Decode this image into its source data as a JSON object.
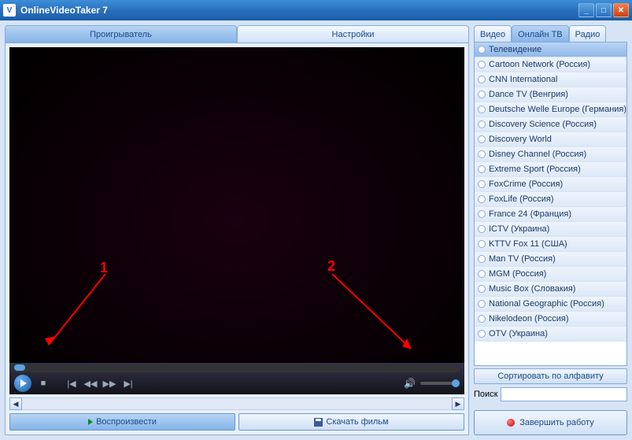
{
  "window": {
    "title": "OnlineVideoTaker 7"
  },
  "mainTabs": {
    "player": "Проигрыватель",
    "settings": "Настройки"
  },
  "sideTabs": {
    "video": "Видео",
    "onlineTV": "Онлайн ТВ",
    "radio": "Радио"
  },
  "buttons": {
    "play": "Воспроизвести",
    "download": "Скачать фильм",
    "sort": "Сортировать по алфавиту",
    "search": "Поиск",
    "exit": "Завершить работу"
  },
  "annotations": {
    "n1": "1",
    "n2": "2"
  },
  "channels": [
    "Телевидение",
    "Cartoon Network (Россия)",
    "CNN International",
    "Dance TV (Венгрия)",
    "Deutsche Welle Europe (Германия)",
    "Discovery Science (Россия)",
    "Discovery World",
    "Disney Channel (Россия)",
    "Extreme Sport (Россия)",
    "FoxCrime (Россия)",
    "FoxLife (Россия)",
    "France 24 (Франция)",
    "ICTV (Украина)",
    "KTTV Fox 11 (США)",
    "Man TV (Россия)",
    "MGM (Россия)",
    "Music Box (Словакия)",
    "National Geographic (Россия)",
    "Nikelodeon (Россия)",
    "OTV (Украина)"
  ]
}
